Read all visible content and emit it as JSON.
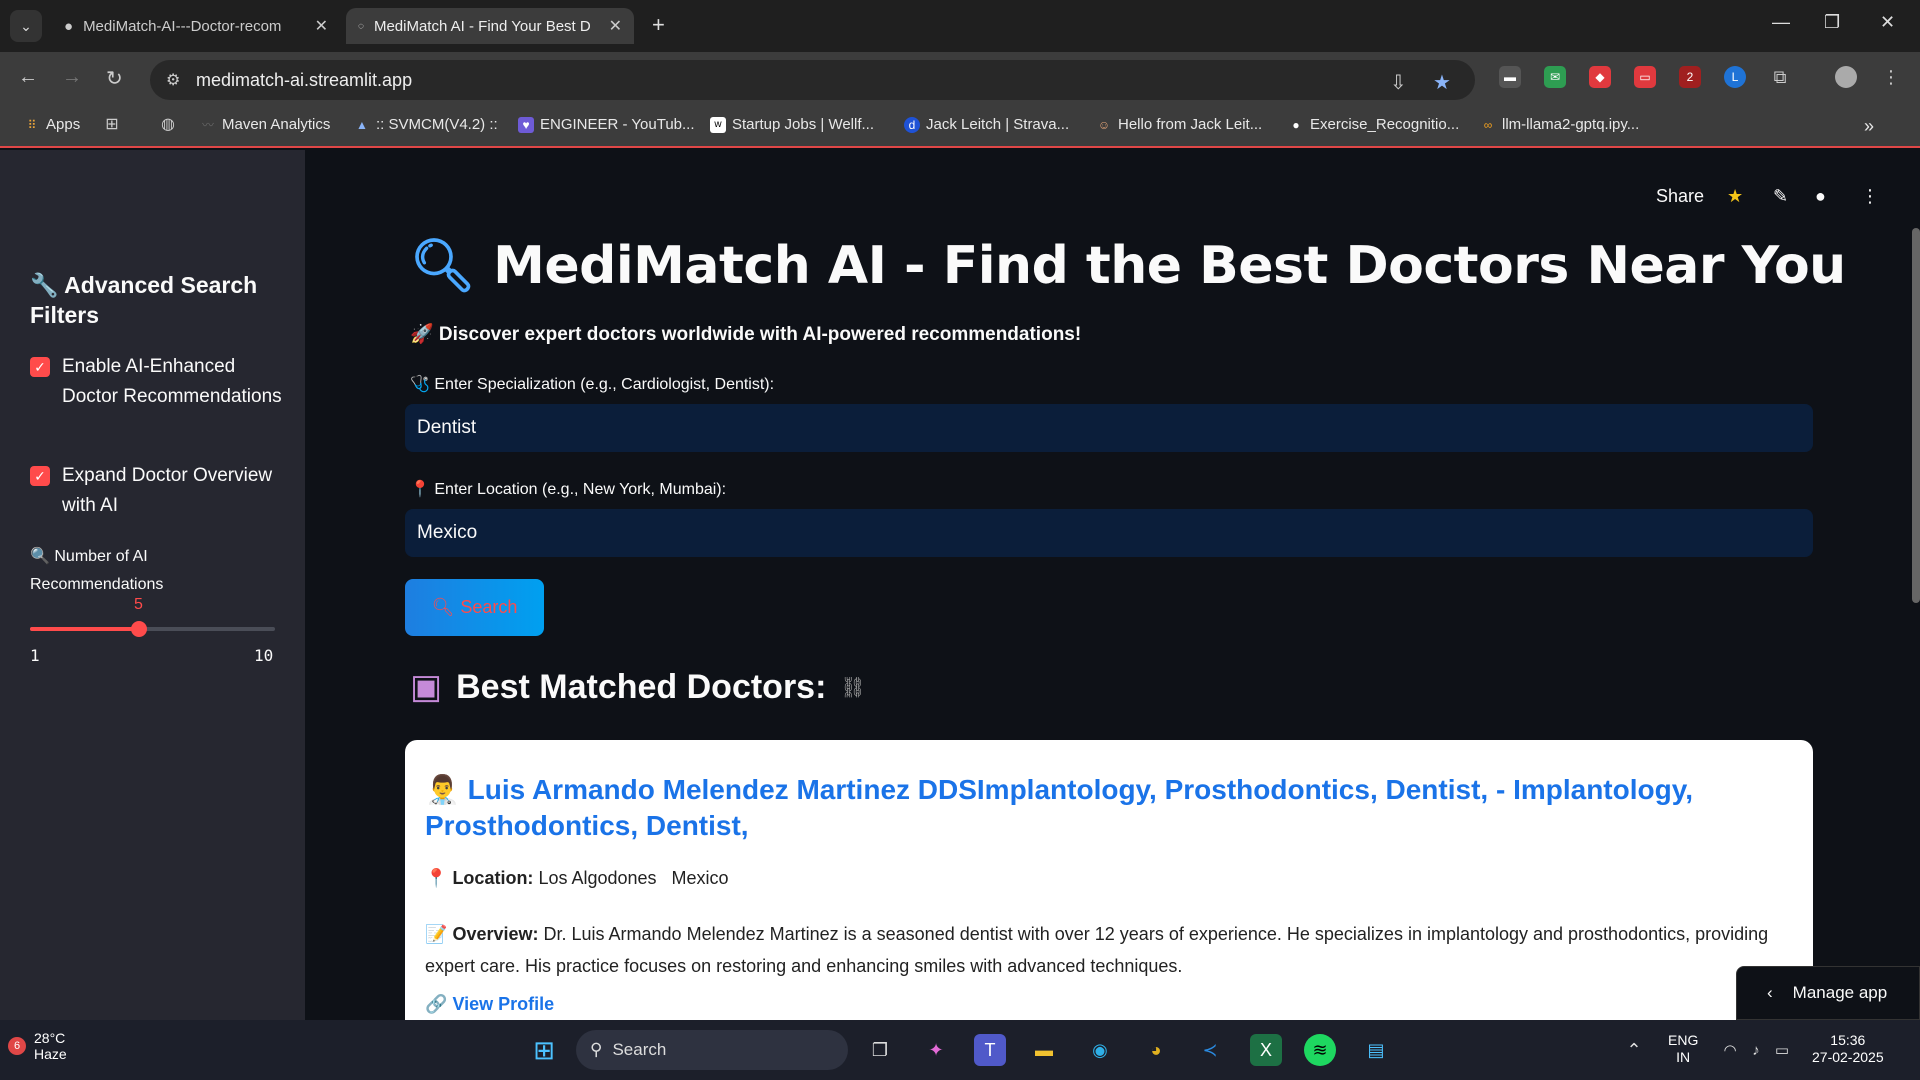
{
  "browser": {
    "tabs": [
      {
        "title": "MediMatch-AI---Doctor-recom",
        "active": false
      },
      {
        "title": "MediMatch AI - Find Your Best D",
        "active": true
      }
    ],
    "url": "medimatch-ai.streamlit.app",
    "bookmarks": [
      "Apps",
      "Maven Analytics",
      ":: SVMCM(V4.2) ::",
      "ENGINEER - YouTub...",
      "Startup Jobs | Wellf...",
      "Jack Leitch | Strava...",
      "Hello from Jack Leit...",
      "Exercise_Recognitio...",
      "llm-llama2-gptq.ipy..."
    ],
    "extension_badge": "2"
  },
  "sidebar": {
    "title": "🔧 Advanced Search Filters",
    "checkboxes": [
      {
        "label": "Enable AI-Enhanced Doctor Recommendations",
        "checked": true
      },
      {
        "label": "Expand Doctor Overview with AI",
        "checked": true
      }
    ],
    "slider": {
      "label": "🔍 Number of AI Recommendations",
      "value": "5",
      "min": "1",
      "max": "10",
      "fraction": 0.444
    }
  },
  "header": {
    "share_label": "Share"
  },
  "main": {
    "title": "MediMatch AI - Find the Best Doctors Near You",
    "subtitle": "🚀 Discover expert doctors worldwide with AI-powered recommendations!",
    "specialization_label": "🩺 Enter Specialization (e.g., Cardiologist, Dentist):",
    "specialization_value": "Dentist",
    "location_label": "📍 Enter Location (e.g., New York, Mumbai):",
    "location_value": "Mexico",
    "search_label": "Search",
    "results_title": "Best Matched Doctors:"
  },
  "doctor": {
    "name": "Luis Armando Melendez Martinez DDSImplantology, Prosthodontics, Dentist, - Implantology, Prosthodontics, Dentist,",
    "location_label": "Location:",
    "location_value": "Los Algodones   Mexico",
    "overview_label": "Overview:",
    "overview_text": "Dr. Luis Armando Melendez Martinez is a seasoned dentist with over 12 years of experience. He specializes in implantology and prosthodontics, providing expert care. His practice focuses on restoring and enhancing smiles with advanced techniques.",
    "profile_link": "View Profile"
  },
  "manage_app": "Manage app",
  "taskbar": {
    "weather_temp": "28°C",
    "weather_desc": "Haze",
    "weather_badge": "6",
    "search": "Search",
    "lang_top": "ENG",
    "lang_bottom": "IN",
    "time": "15:36",
    "date": "27-02-2025"
  },
  "colors": {
    "accent": "#ff4b4b",
    "link": "#1a73e8",
    "input_bg": "#0b1e3a",
    "sidebar_bg": "#262730"
  }
}
